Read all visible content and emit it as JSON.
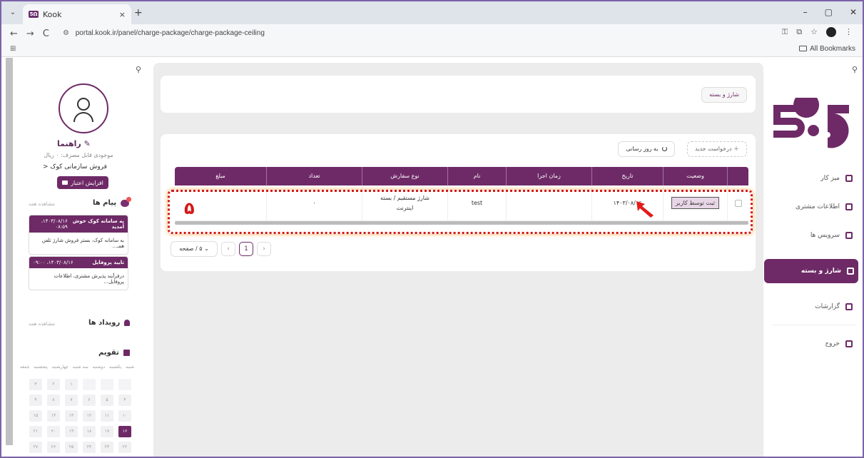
{
  "browser": {
    "tab_title": "Kook",
    "tab_close": "×",
    "new_tab": "+",
    "tab_menu": "⌄",
    "url": "portal.kook.ir/panel/charge-package/charge-package-ceiling",
    "all_bookmarks": "All Bookmarks",
    "nav_back": "←",
    "nav_forward": "→",
    "nav_reload": "C",
    "win_min": "–",
    "win_max": "▢",
    "win_close": "✕"
  },
  "sidebar_left": {
    "username": "راهنما",
    "credit": "موجودی قابل مصرف: ۰ ریال",
    "kook_sale": "فروش سازمانی کوک",
    "increase_btn": "افزایش اعتبار",
    "messages": {
      "title": "پیام ها",
      "see_all": "مشاهده همه",
      "cards": [
        {
          "title": "به سامانه کوک خوش آمدید",
          "time": "۱۴۰۳/۰۸/۱۶، ۰۸:۵۹",
          "body": "به سامانه کوک، بستر فروش شارژ تلفن همـ..."
        },
        {
          "title": "تایید پروفایل",
          "time": "۱۴۰۳/۰۸/۱۶، ۰۹:۰۰",
          "body": "درفرآیند پذیرش مشتری، اطلاعات پروفایل..."
        }
      ]
    },
    "events": {
      "title": "رویداد ها",
      "see_all": "مشاهده همه"
    },
    "calendar": {
      "title": "تقویم",
      "weekdays": [
        "شنبه",
        "یکشنبه",
        "دوشنبه",
        "سه شنبه",
        "چهارشنبه",
        "پنجشنبه",
        "جمعه"
      ],
      "cells": [
        "",
        "",
        "",
        "۱",
        "۲",
        "۳",
        "۴",
        "۵",
        "۶",
        "۷",
        "۸",
        "۹",
        "۱۰",
        "۱۱",
        "۱۲",
        "۱۳",
        "۱۴",
        "۱۵",
        "۱۶",
        "۱۷",
        "۱۸",
        "۱۹",
        "۲۰",
        "۲۱",
        "۲۲",
        "۲۳",
        "۲۴",
        "۲۵",
        "۲۶",
        "۲۷"
      ],
      "today": "۱۶"
    }
  },
  "main": {
    "breadcrumb": "شارژ و بسته",
    "new_request": "درخواست جدید",
    "refresh": "به روز رسانی",
    "columns": [
      "",
      "وضعیت",
      "تاریخ",
      "زمان اجرا",
      "نام",
      "نوع سفارش",
      "تعداد",
      "مبلغ"
    ],
    "row": {
      "status": "ثبت توسط کاربر",
      "date": "۱۴۰۳/۰۸/۱۶",
      "exec_time": "",
      "name": "test",
      "order_type": "شارژ مستقیم / بسته اینترنت",
      "count": "۰",
      "amount": ""
    },
    "annotation_number": "۵",
    "pager": {
      "per_page": "۵ / صفحه",
      "page": "1",
      "prev": "‹",
      "next": "›"
    }
  },
  "sidebar_right": {
    "nav": [
      {
        "label": "میز کار"
      },
      {
        "label": "اطلاعات مشتری"
      },
      {
        "label": "سرویس ها"
      },
      {
        "label": "شارژ و بسته"
      },
      {
        "label": "گزارشات"
      },
      {
        "label": "خروج"
      }
    ]
  },
  "colors": {
    "brand": "#6e2a66",
    "highlight": "#d21818"
  }
}
